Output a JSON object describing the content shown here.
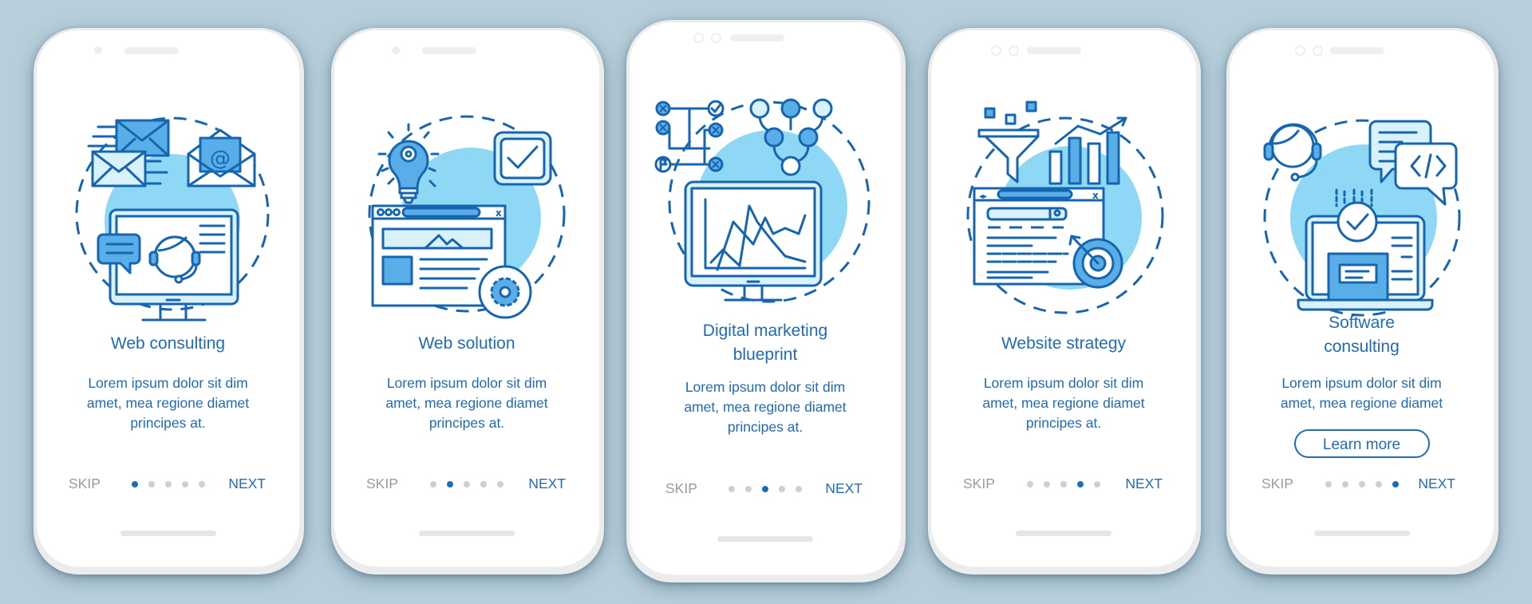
{
  "colors": {
    "background": "#b8cfdb",
    "accent": "#1f6bb5",
    "muted_text": "#9a9a9a",
    "icon_stroke": "#1565b0",
    "icon_fill": "#5aaee8",
    "icon_light_fill": "#d8f1fb",
    "circle_bg": "#8fd8f5",
    "dot_inactive": "#cfcfcf"
  },
  "screens": [
    {
      "title": "Web consulting",
      "body": [
        "Lorem ipsum dolor sit dim",
        "amet, mea regione diamet",
        "principes at."
      ],
      "skip_label": "SKIP",
      "next_label": "NEXT",
      "active_page": 1,
      "total_pages": 5,
      "illustration": "web-consulting-illustration"
    },
    {
      "title": "Web solution",
      "body": [
        "Lorem ipsum dolor sit dim",
        "amet, mea regione diamet",
        "principes at."
      ],
      "skip_label": "SKIP",
      "next_label": "NEXT",
      "active_page": 2,
      "total_pages": 5,
      "illustration": "web-solution-illustration"
    },
    {
      "title": [
        "Digital marketing",
        "blueprint"
      ],
      "body": [
        "Lorem ipsum dolor sit dim",
        "amet, mea regione diamet",
        "principes at."
      ],
      "skip_label": "SKIP",
      "next_label": "NEXT",
      "active_page": 3,
      "total_pages": 5,
      "illustration": "digital-marketing-blueprint-illustration"
    },
    {
      "title": "Website strategy",
      "body": [
        "Lorem ipsum dolor sit dim",
        "amet, mea regione diamet",
        "principes at."
      ],
      "skip_label": "SKIP",
      "next_label": "NEXT",
      "active_page": 4,
      "total_pages": 5,
      "illustration": "website-strategy-illustration"
    },
    {
      "title": [
        "Software",
        "consulting"
      ],
      "body": [
        "Lorem ipsum dolor sit dim",
        "amet, mea regione diamet"
      ],
      "button_label": "Learn more",
      "skip_label": "SKIP",
      "next_label": "NEXT",
      "active_page": 5,
      "total_pages": 5,
      "illustration": "software-consulting-illustration"
    }
  ]
}
